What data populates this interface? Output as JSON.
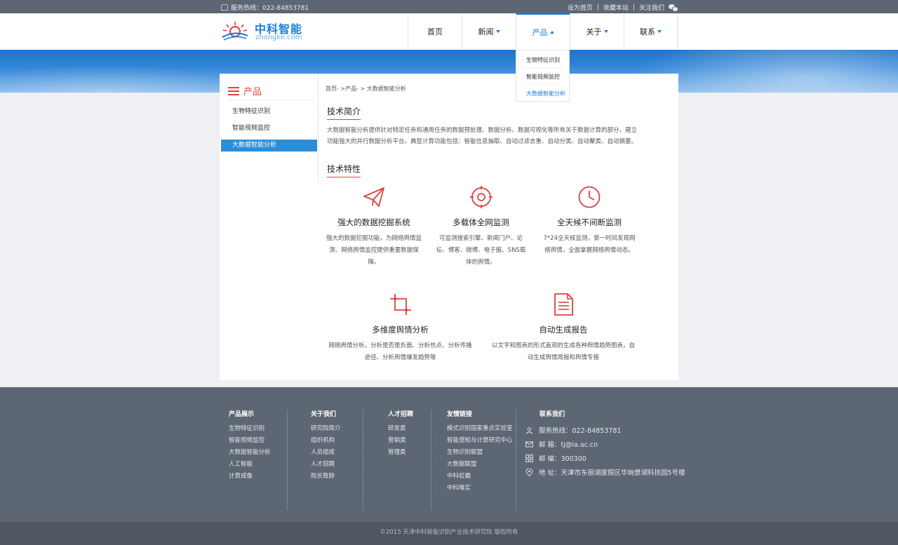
{
  "topbar": {
    "hotline": "服务热线：022-84853781",
    "links": [
      "设为首页",
      "收藏本站",
      "关注我们"
    ],
    "separator": "|"
  },
  "logo": {
    "cn": "中科智能",
    "en": "zhongke.com"
  },
  "nav": {
    "items": [
      {
        "label": "首页",
        "caret": "none"
      },
      {
        "label": "新闻",
        "caret": "down"
      },
      {
        "label": "产品",
        "caret": "up"
      },
      {
        "label": "关于",
        "caret": "down"
      },
      {
        "label": "联系",
        "caret": "down"
      }
    ],
    "active_index": 2
  },
  "dropdown": {
    "items": [
      "生物特征识别",
      "智能视频监控",
      "大数据智能分析"
    ],
    "selected_index": 2
  },
  "sidebar": {
    "title": "产品",
    "items": [
      "生物特征识别",
      "智能视频监控",
      "大数据智能分析"
    ],
    "selected_index": 2
  },
  "breadcrumb": "首页- >产品- > 大数据智能分析",
  "intro": {
    "title": "技术简介",
    "text": "大数据智能分析提供针对特定任务和通用任务的数据预处理、数据分析、数据可视化等所有关于数据计算的部分，建立功能强大的并行数据分析平台。典型计算功能包括：智能信息抽取、自动过滤去重、自动分类、自动聚类、自动摘要。"
  },
  "features": {
    "title": "技术特性",
    "items": [
      {
        "icon": "paper-plane-icon",
        "name": "强大的数据挖掘系统",
        "desc": "强大的数据挖掘功能，为网络舆情监测、网络舆情监控提供重要数据保障。"
      },
      {
        "icon": "target-icon",
        "name": "多载体全网监测",
        "desc": "可监测搜索引擎、新闻门户、论坛、博客、微博、电子报、SNS载体的舆情。"
      },
      {
        "icon": "clock-icon",
        "name": "全天候不间断监测",
        "desc": "7*24全天候监测，第一时间发现网络舆情，全面掌握网络舆情动态。"
      },
      {
        "icon": "crop-icon",
        "name": "多维度舆情分析",
        "desc": "网络舆情分析，分析是否是负面、分析热点、分析传播途径、分析舆情爆发趋势等"
      },
      {
        "icon": "report-icon",
        "name": "自动生成报告",
        "desc": "以文字和图表的形式直观的生成各种舆情趋势图表，自动生成舆情简报和舆情专报"
      }
    ]
  },
  "footer": {
    "columns": [
      {
        "heading": "产品展示",
        "links": [
          "生物特征识别",
          "智能视频监控",
          "大数据智能分析",
          "人工智能",
          "计算成像"
        ]
      },
      {
        "heading": "关于我们",
        "links": [
          "研究院简介",
          "组织机构",
          "人员组成",
          "人才招聘",
          "院长致辞"
        ]
      },
      {
        "heading": "人才招聘",
        "links": [
          "研发类",
          "营销类",
          "管理类"
        ]
      },
      {
        "heading": "友情链接",
        "links": [
          "模式识别国家重点实验室",
          "智能感知与计算研究中心",
          "生物识别联盟",
          "大数据联盟",
          "中科虹霸",
          "中科唯实"
        ]
      }
    ],
    "contact": {
      "heading": "联系我们",
      "rows": [
        {
          "icon": "phone-icon",
          "text": "服务热线：022-84853781"
        },
        {
          "icon": "mail-icon",
          "text": "邮  箱：tj@ia.ac.cn"
        },
        {
          "icon": "grid-icon",
          "text": "邮  编：300300"
        },
        {
          "icon": "location-icon",
          "text": "地  址：天津市东丽湖度假区华纳景湖科技园5号楼"
        }
      ]
    },
    "copyright": "©2015 天津中科智能识别产业技术研究院 版权所有"
  },
  "colors": {
    "accent": "#1a7ed6",
    "highlight": "#e04040",
    "topbar": "#5d6673",
    "footer": "#5d6673",
    "copyright_bar": "#4e5660"
  }
}
